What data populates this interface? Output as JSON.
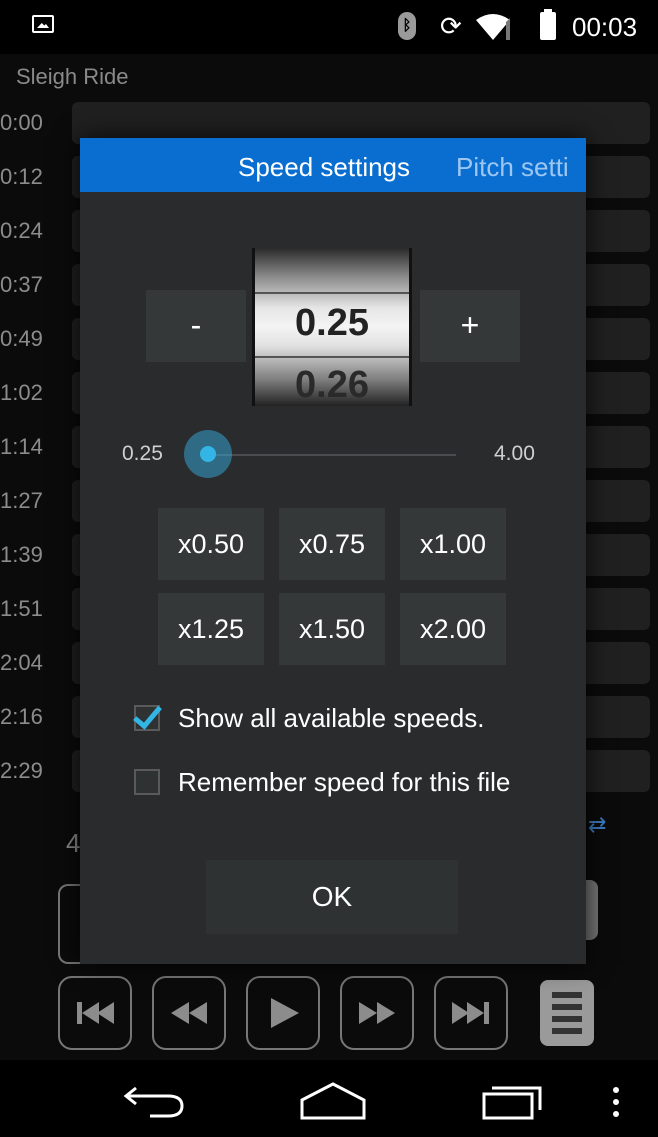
{
  "status_bar": {
    "time": "00:03",
    "icons": [
      "gallery-icon",
      "bluetooth-icon",
      "rotate-icon",
      "wifi-icon",
      "signal-icon",
      "battery-icon"
    ]
  },
  "player": {
    "song_title": "Sleigh Ride",
    "timeline": [
      "0:00",
      "0:12",
      "0:24",
      "0:37",
      "0:49",
      "1:02",
      "1:14",
      "1:27",
      "1:39",
      "1:51",
      "2:04",
      "2:16",
      "2:29"
    ],
    "partial_label": "4"
  },
  "dialog": {
    "tabs": {
      "speed": "Speed settings",
      "pitch": "Pitch setti"
    },
    "minus_label": "-",
    "plus_label": "+",
    "current_speed": "0.25",
    "next_speed": "0.26",
    "slider": {
      "min": "0.25",
      "max": "4.00",
      "value": 0.25
    },
    "presets": [
      "x0.50",
      "x0.75",
      "x1.00",
      "x1.25",
      "x1.50",
      "x2.00"
    ],
    "show_all_label": "Show all available speeds.",
    "show_all_checked": true,
    "remember_label": "Remember speed for this file",
    "remember_checked": false,
    "ok_label": "OK"
  },
  "controls": [
    "skip-back-icon",
    "rewind-icon",
    "play-icon",
    "fast-forward-icon",
    "skip-forward-icon",
    "playlist-icon"
  ],
  "nav_bar": [
    "back-icon",
    "home-icon",
    "recent-apps-icon",
    "menu-icon"
  ],
  "colors": {
    "accent": "#0a6ed1",
    "checkbox": "#33b5e5",
    "dialog_bg": "#292b2c"
  }
}
